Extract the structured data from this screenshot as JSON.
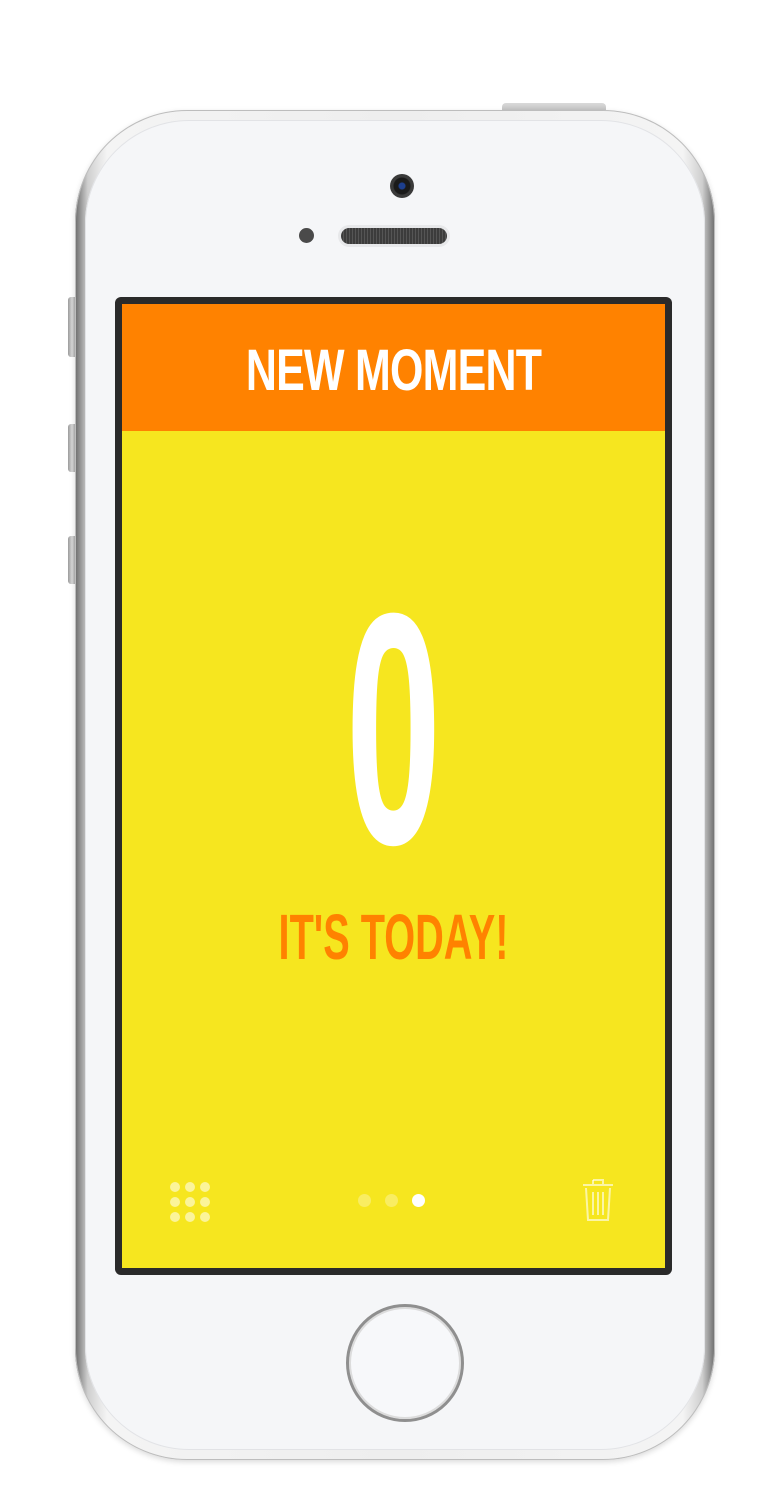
{
  "screen": {
    "header": {
      "title": "NEW MOMENT",
      "background_color": "#ff8200",
      "text_color": "#ffffff"
    },
    "countdown": {
      "value": "0",
      "caption": "IT'S TODAY!",
      "value_color": "#ffffff",
      "caption_color": "#ff8200"
    },
    "background_color": "#f6e61f",
    "toolbar": {
      "left_icon": "grid-icon",
      "right_icon": "trash-icon",
      "pager": {
        "count": 3,
        "active_index": 2
      }
    }
  }
}
